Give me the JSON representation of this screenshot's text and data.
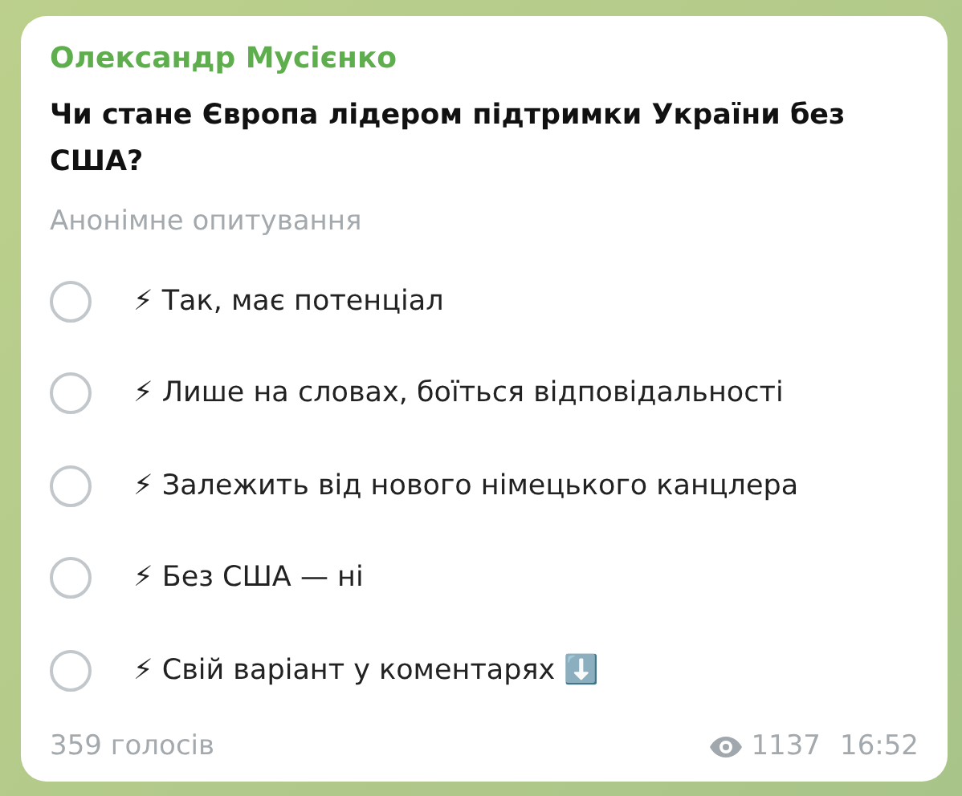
{
  "message": {
    "author": "Олександр Мусієнко",
    "question": "Чи стане Європа лідером підтримки України без США?",
    "poll_type": "Анонімне опитування",
    "options": [
      {
        "text": "⚡ Так, має потенціал",
        "selected": false
      },
      {
        "text": "⚡ Лише на словах, боїться відповідальності",
        "selected": false
      },
      {
        "text": "⚡ Залежить від нового німецького канцлера",
        "selected": false
      },
      {
        "text": "⚡ Без США — ні",
        "selected": false
      },
      {
        "text": "⚡ Свій варіант у коментарях ⬇️",
        "selected": false
      }
    ],
    "votes": "359 голосів",
    "views": "1137",
    "time": "16:52"
  }
}
